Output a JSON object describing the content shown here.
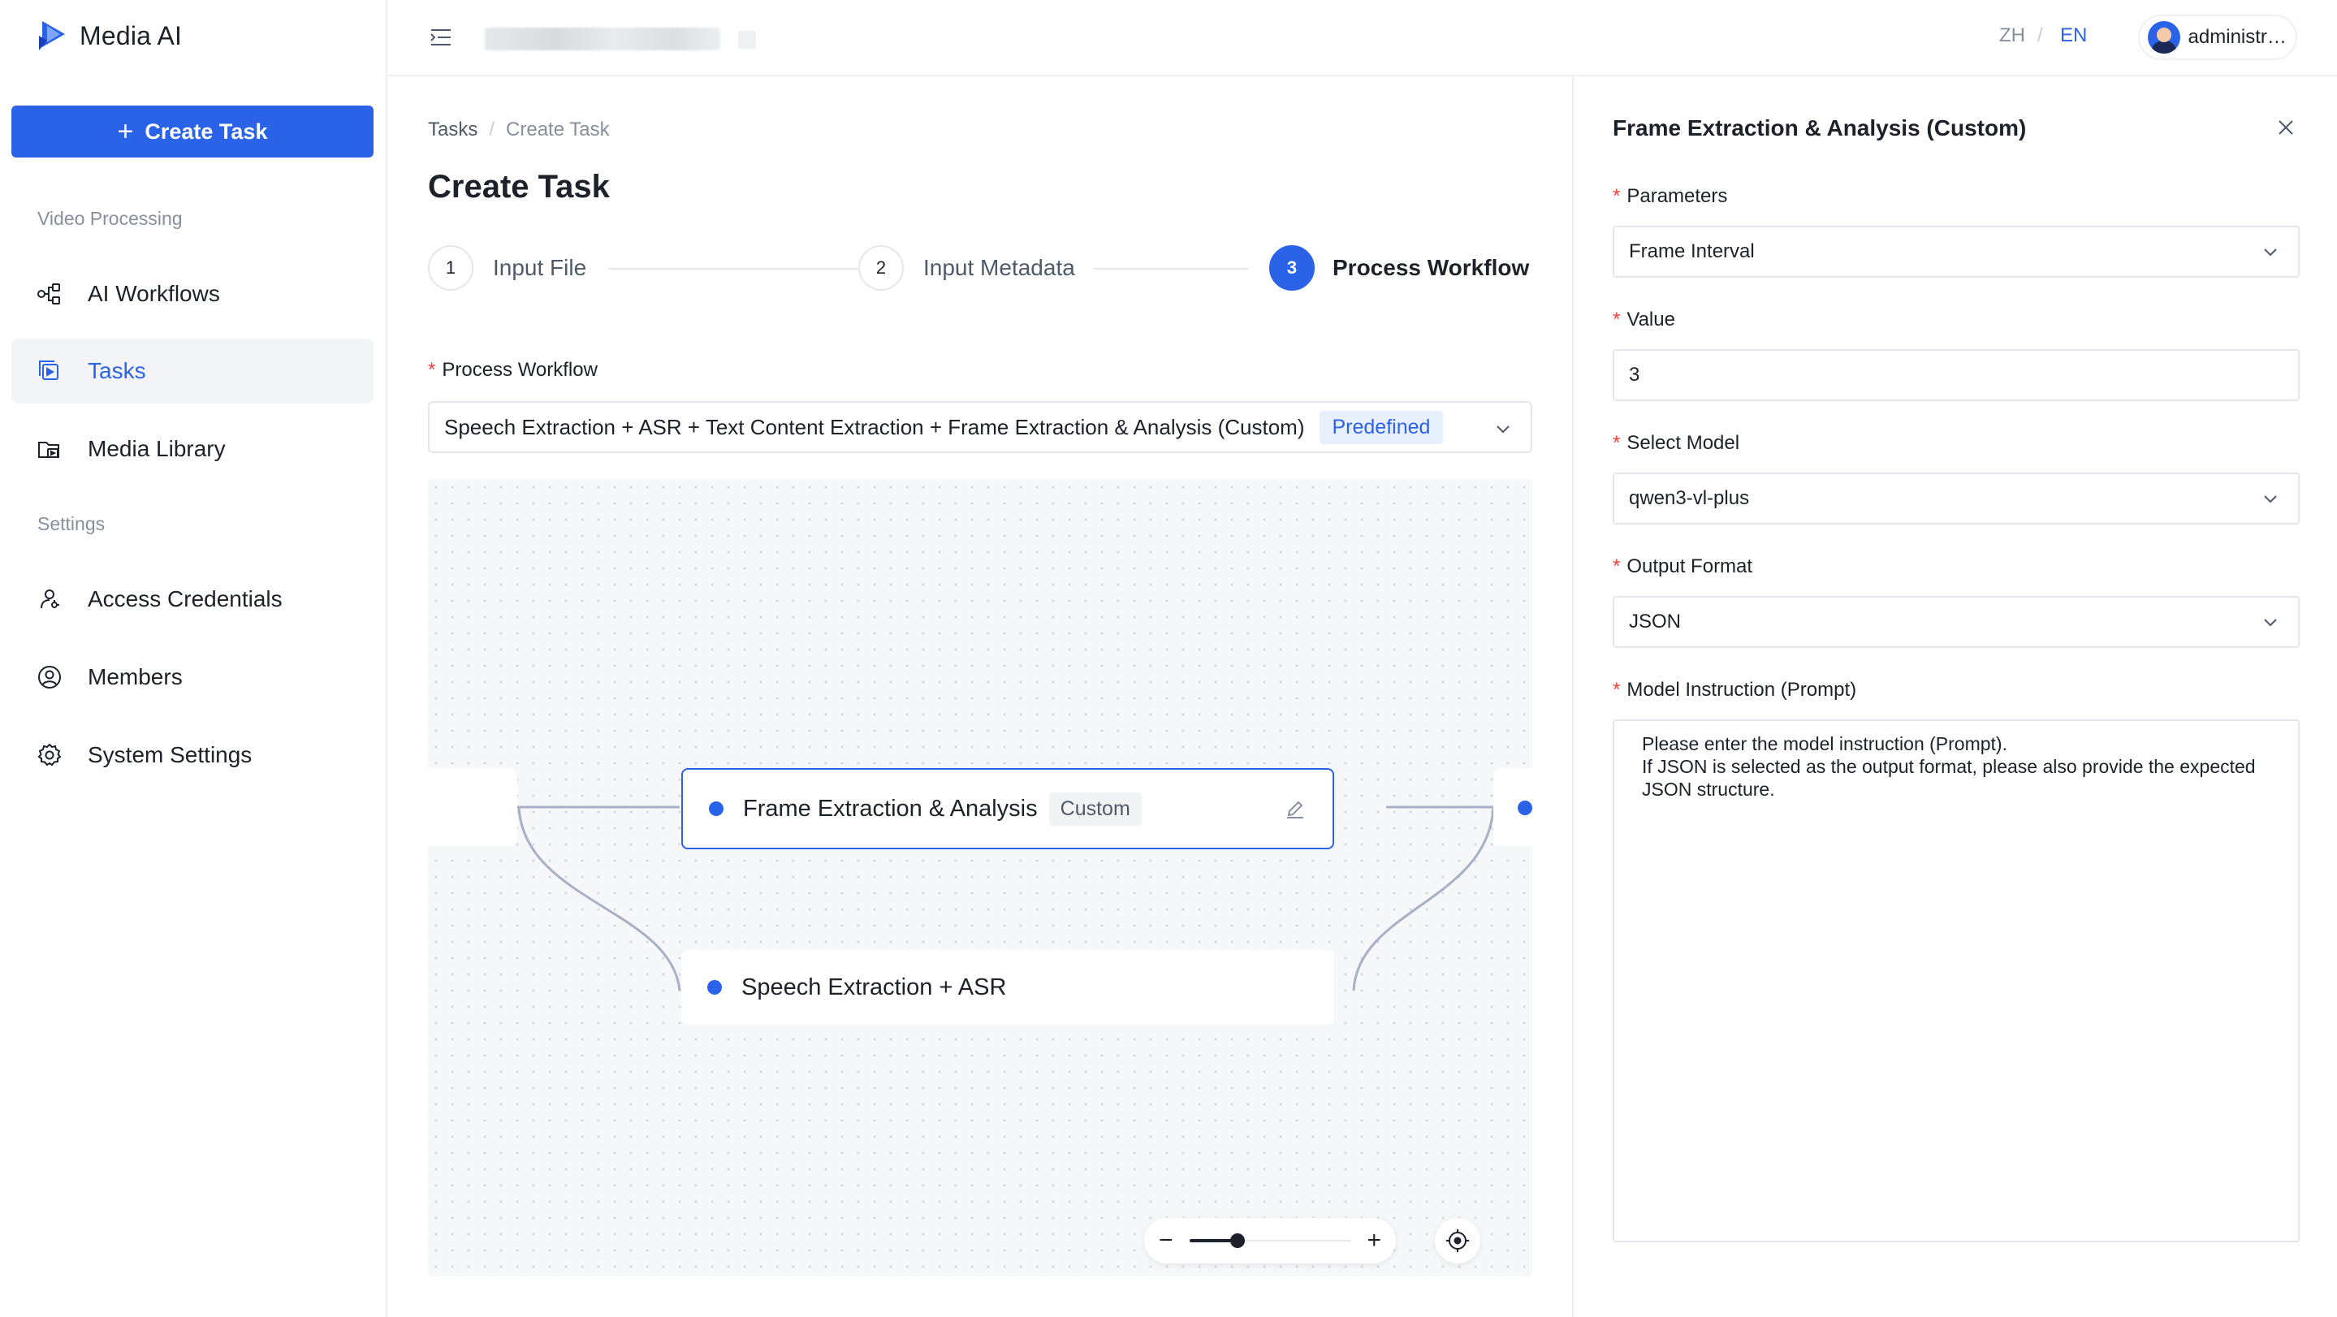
{
  "app": {
    "name": "Media AI"
  },
  "sidebar": {
    "create_label": "Create Task",
    "sections": [
      "Video Processing",
      "Settings"
    ],
    "items": [
      {
        "label": "AI Workflows",
        "icon": "workflow-icon"
      },
      {
        "label": "Tasks",
        "icon": "tasks-icon",
        "active": true
      },
      {
        "label": "Media Library",
        "icon": "media-library-icon"
      },
      {
        "label": "Access Credentials",
        "icon": "key-user-icon"
      },
      {
        "label": "Members",
        "icon": "user-circle-icon"
      },
      {
        "label": "System Settings",
        "icon": "gear-icon"
      }
    ]
  },
  "topbar": {
    "lang_zh": "ZH",
    "lang_sep": "/",
    "lang_en": "EN",
    "active_lang": "EN",
    "user": "administrator"
  },
  "main": {
    "breadcrumb": [
      "Tasks",
      "Create Task"
    ],
    "breadcrumb_sep": "/",
    "title": "Create Task",
    "steps": [
      {
        "num": "1",
        "label": "Input File"
      },
      {
        "num": "2",
        "label": "Input Metadata"
      },
      {
        "num": "3",
        "label": "Process Workflow",
        "active": true
      }
    ],
    "workflow_label": "Process Workflow",
    "workflow_value": "Speech Extraction + ASR + Text Content Extraction + Frame Extraction & Analysis (Custom)",
    "workflow_tag": "Predefined",
    "nodes": [
      {
        "label": "Frame Extraction & Analysis",
        "tag": "Custom",
        "selected": true
      },
      {
        "label": "Speech Extraction + ASR"
      }
    ],
    "zoom_level": 0.3
  },
  "panel": {
    "title": "Frame Extraction & Analysis (Custom)",
    "fields": {
      "parameters": {
        "label": "Parameters",
        "value": "Frame Interval"
      },
      "value": {
        "label": "Value",
        "value": "3"
      },
      "model": {
        "label": "Select Model",
        "value": "qwen3-vl-plus"
      },
      "output_format": {
        "label": "Output Format",
        "value": "JSON"
      },
      "prompt": {
        "label": "Model Instruction (Prompt)",
        "placeholder": "Please enter the model instruction (Prompt).\nIf JSON is selected as the output format, please also provide the expected JSON structure."
      }
    }
  },
  "colors": {
    "accent": "#2b63e8",
    "required": "#f53f3f",
    "text": "#1d2129",
    "muted": "#86909c"
  }
}
